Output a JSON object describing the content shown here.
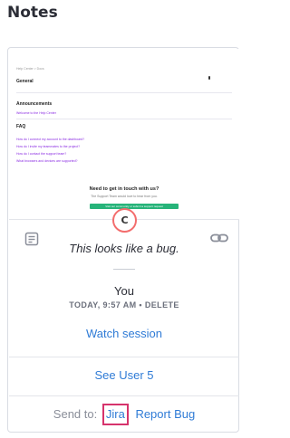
{
  "panel": {
    "title": "Notes"
  },
  "thumbnail": {
    "breadcrumb": "Help Center > Docs",
    "section_general": "General",
    "section_announcements": "Announcements",
    "announcement_link": "Welcome to the Help Center",
    "section_faq": "FAQ",
    "faq_links": [
      "How do I connect my account to the dashboard?",
      "How do I invite my teammates to the project?",
      "How do I contact the support team?",
      "What browsers and devices are supported?"
    ],
    "cta_title": "Need to get in touch with us?",
    "cta_subtitle": "The Support Team would love to hear from you.",
    "cta_button": "Visit our community or submit a support request"
  },
  "session_avatar": {
    "initial": "C",
    "color": "#f36d6d"
  },
  "note": {
    "text": "This looks like a bug.",
    "author": "You",
    "timestamp": "TODAY, 9:57 AM",
    "separator": "•",
    "delete_label": "DELETE"
  },
  "actions": {
    "watch_session": "Watch session",
    "see_user": "See User 5",
    "send_to_label": "Send to:",
    "jira": "Jira",
    "report_bug": "Report Bug"
  },
  "colors": {
    "link": "#2f7bd6",
    "highlight": "#d6336c",
    "text": "#2b2d36"
  }
}
